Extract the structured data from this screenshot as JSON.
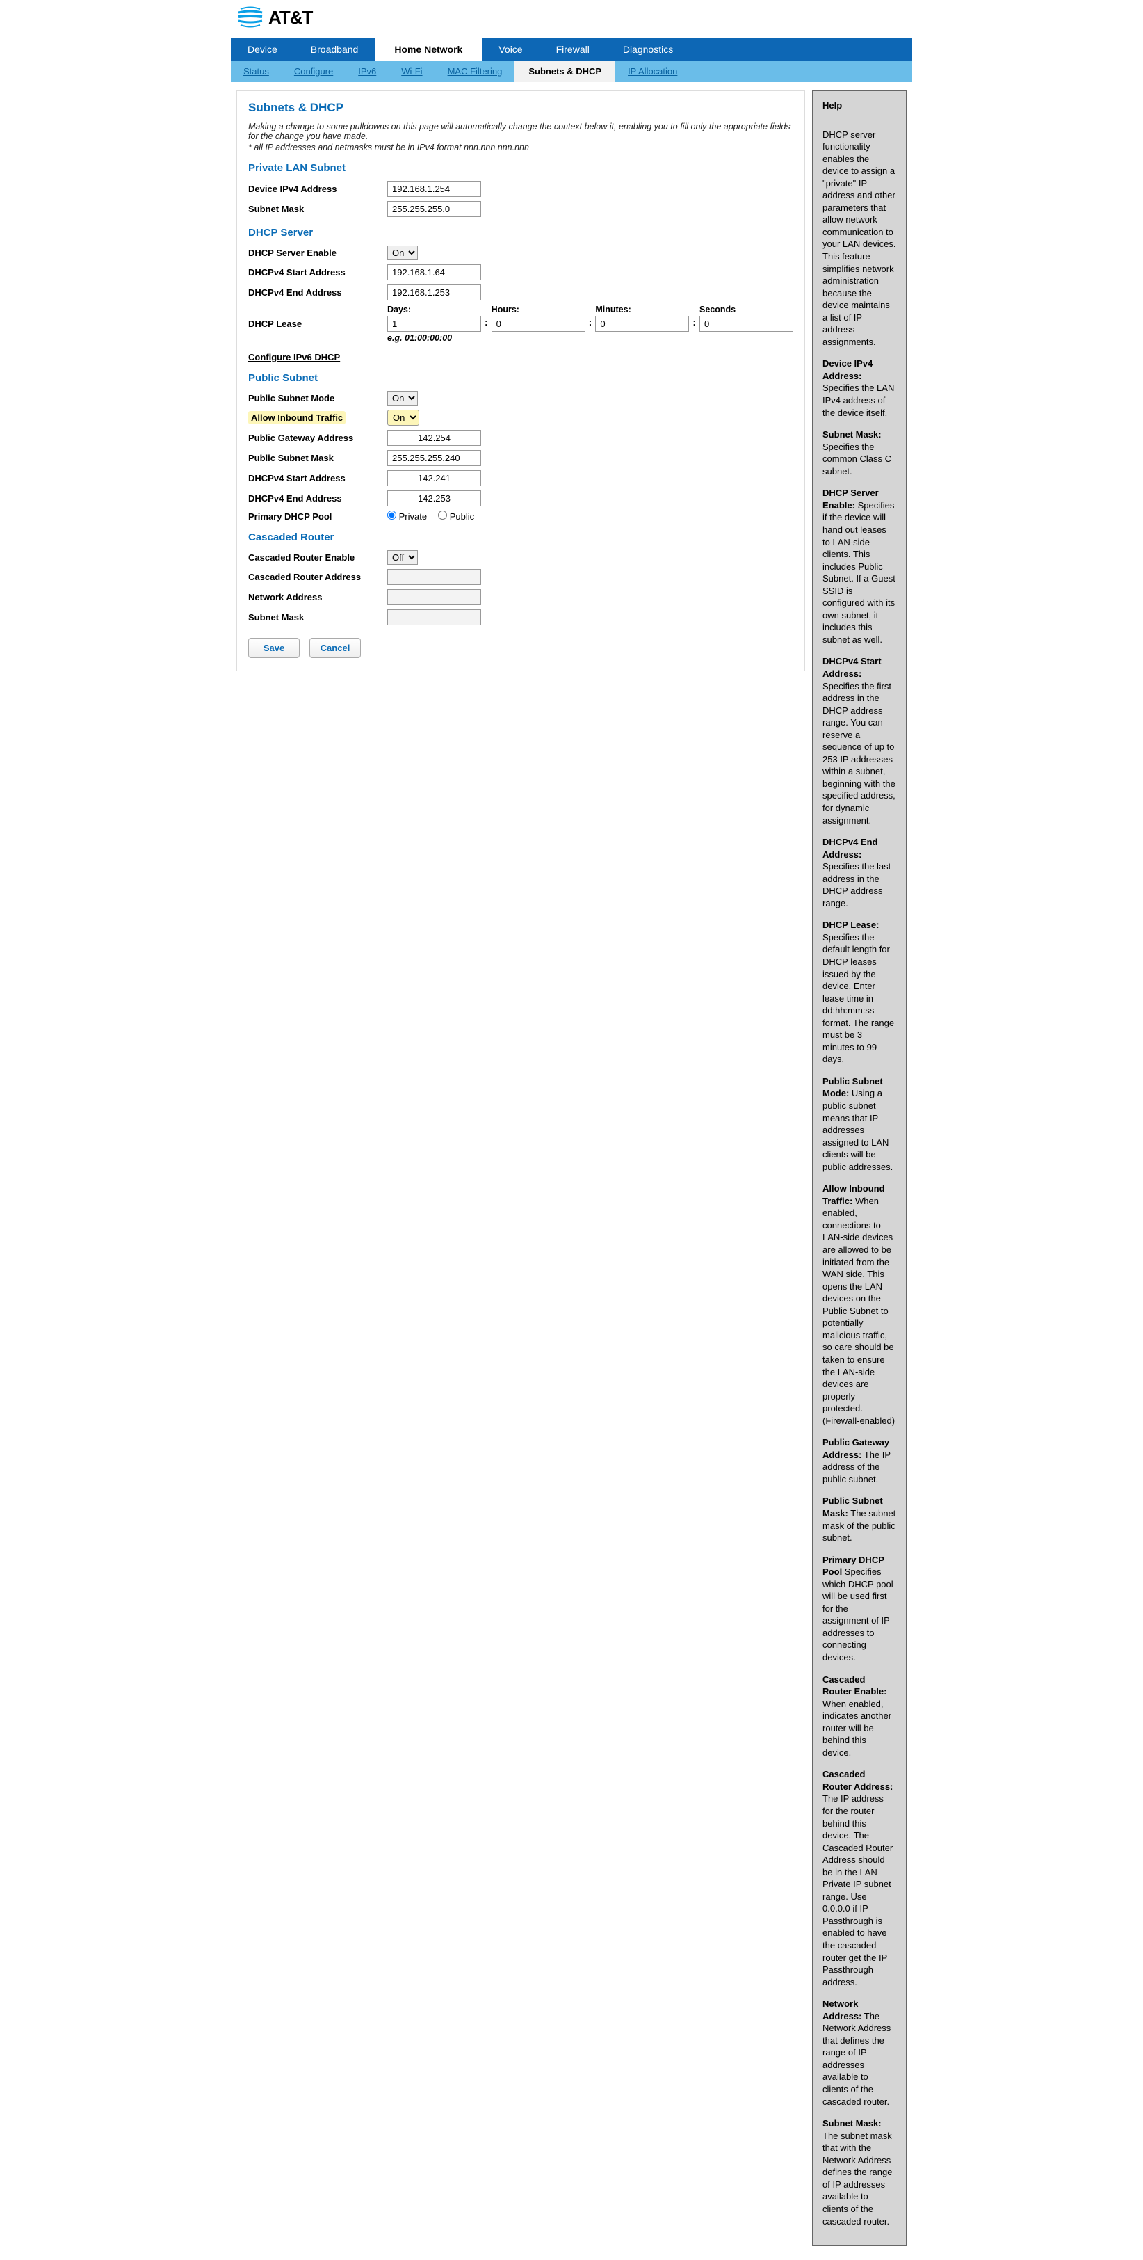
{
  "logo": {
    "text": "AT&T"
  },
  "primary_tabs": [
    "Device",
    "Broadband",
    "Home Network",
    "Voice",
    "Firewall",
    "Diagnostics"
  ],
  "primary_active": 2,
  "secondary_tabs": [
    "Status",
    "Configure",
    "IPv6",
    "Wi-Fi",
    "MAC Filtering",
    "Subnets & DHCP",
    "IP Allocation"
  ],
  "secondary_active": 5,
  "page_title": "Subnets & DHCP",
  "intro_line1": "Making a change to some pulldowns on this page will automatically change the context below it, enabling you to fill only the appropriate fields for the change you have made.",
  "intro_line2": "* all IP addresses and netmasks must be in IPv4 format nnn.nnn.nnn.nnn",
  "private_lan": {
    "heading": "Private LAN Subnet",
    "device_ipv4_label": "Device IPv4 Address",
    "device_ipv4": "192.168.1.254",
    "subnet_mask_label": "Subnet Mask",
    "subnet_mask": "255.255.255.0"
  },
  "dhcp_server": {
    "heading": "DHCP Server",
    "enable_label": "DHCP Server Enable",
    "enable": "On",
    "start_label": "DHCPv4 Start Address",
    "start": "192.168.1.64",
    "end_label": "DHCPv4 End Address",
    "end": "192.168.1.253",
    "lease_label": "DHCP Lease",
    "days_label": "Days:",
    "hours_label": "Hours:",
    "minutes_label": "Minutes:",
    "seconds_label": "Seconds",
    "days": "1",
    "hours": "0",
    "minutes": "0",
    "seconds": "0",
    "eg": "e.g. 01:00:00:00",
    "ipv6_link": "Configure IPv6 DHCP"
  },
  "public_subnet": {
    "heading": "Public Subnet",
    "mode_label": "Public Subnet Mode",
    "mode": "On",
    "allow_inbound_label": "Allow Inbound Traffic",
    "allow_inbound": "On",
    "gateway_label": "Public Gateway Address",
    "gateway": "142.254",
    "mask_label": "Public Subnet Mask",
    "mask": "255.255.255.240",
    "start_label": "DHCPv4 Start Address",
    "start": "142.241",
    "end_label": "DHCPv4 End Address",
    "end": "142.253",
    "pool_label": "Primary DHCP Pool",
    "pool_private": "Private",
    "pool_public": "Public"
  },
  "cascaded": {
    "heading": "Cascaded Router",
    "enable_label": "Cascaded Router Enable",
    "enable": "Off",
    "address_label": "Cascaded Router Address",
    "address": "",
    "network_label": "Network Address",
    "network": "",
    "mask_label": "Subnet Mask",
    "mask": ""
  },
  "buttons": {
    "save": "Save",
    "cancel": "Cancel"
  },
  "help": {
    "title": "Help",
    "p_intro": "DHCP server functionality enables the device to assign a \"private\" IP address and other parameters that allow network communication to your LAN devices. This feature simplifies network administration because the device maintains a list of IP address assignments.",
    "p_device_b": "Device IPv4 Address:",
    "p_device_t": " Specifies the LAN IPv4 address of the device itself.",
    "p_subnet_b": "Subnet Mask:",
    "p_subnet_t": " Specifies the common Class C subnet.",
    "p_dhcpen_b": "DHCP Server Enable:",
    "p_dhcpen_t": " Specifies if the device will hand out leases to LAN-side clients. This includes Public Subnet. If a Guest SSID is configured with its own subnet, it includes this subnet as well.",
    "p_start_b": "DHCPv4 Start Address:",
    "p_start_t": " Specifies the first address in the DHCP address range. You can reserve a sequence of up to 253 IP addresses within a subnet, beginning with the specified address, for dynamic assignment.",
    "p_end_b": "DHCPv4 End Address:",
    "p_end_t": " Specifies the last address in the DHCP address range.",
    "p_lease_b": "DHCP Lease:",
    "p_lease_t": " Specifies the default length for DHCP leases issued by the device. Enter lease time in dd:hh:mm:ss format. The range must be 3 minutes to 99 days.",
    "p_psm_b": "Public Subnet Mode:",
    "p_psm_t": " Using a public subnet means that IP addresses assigned to LAN clients will be public addresses.",
    "p_inbound_b": "Allow Inbound Traffic:",
    "p_inbound_t": " When enabled, connections to LAN-side devices are allowed to be initiated from the WAN side. This opens the LAN devices on the Public Subnet to potentially malicious traffic, so care should be taken to ensure the LAN-side devices are properly protected. (Firewall-enabled)",
    "p_pga_b": "Public Gateway Address:",
    "p_pga_t": " The IP address of the public subnet.",
    "p_psmask_b": "Public Subnet Mask:",
    "p_psmask_t": " The subnet mask of the public subnet.",
    "p_pool_b": "Primary DHCP Pool",
    "p_pool_t": " Specifies which DHCP pool will be used first for the assignment of IP addresses to connecting devices.",
    "p_cre_b": "Cascaded Router Enable:",
    "p_cre_t": " When enabled, indicates another router will be behind this device.",
    "p_cra_b": "Cascaded Router Address:",
    "p_cra_t": " The IP address for the router behind this device. The Cascaded Router Address should be in the LAN Private IP subnet range. Use 0.0.0.0 if IP Passthrough is enabled to have the cascaded router get the IP Passthrough address.",
    "p_na_b": "Network Address:",
    "p_na_t": " The Network Address that defines the range of IP addresses available to clients of the cascaded router.",
    "p_sm_b": "Subnet Mask:",
    "p_sm_t": " The subnet mask that with the Network Address defines the range of IP addresses available to clients of the cascaded router."
  }
}
